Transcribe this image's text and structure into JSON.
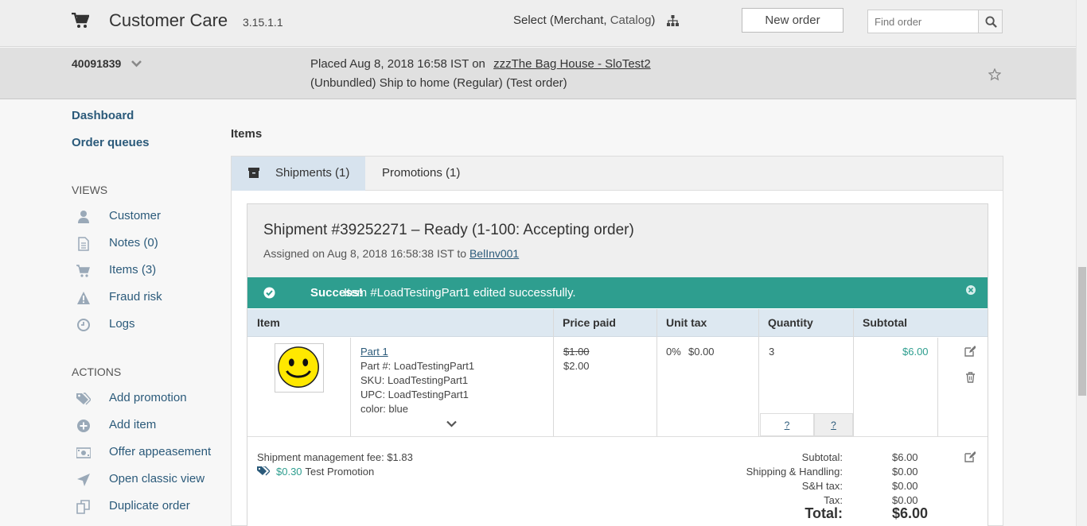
{
  "header": {
    "title": "Customer Care",
    "version": "3.15.1.1",
    "select_prefix": "Select (Merchant, ",
    "select_catalog": "Catalog",
    "select_suffix": ")",
    "new_order": "New order",
    "find_placeholder": "Find order"
  },
  "order": {
    "number": "40091839",
    "placed_text": "Placed Aug 8, 2018 16:58 IST on",
    "store_link": "zzzThe Bag House - SloTest2",
    "ship_text": "(Unbundled)  Ship to home (Regular) (Test order)"
  },
  "sidebar": {
    "dashboard": "Dashboard",
    "order_queues": "Order queues",
    "views_heading": "VIEWS",
    "views": [
      {
        "label": "Customer",
        "icon": "user-icon"
      },
      {
        "label": "Notes (0)",
        "icon": "document-icon"
      },
      {
        "label": "Items (3)",
        "icon": "cart-icon"
      },
      {
        "label": "Fraud risk",
        "icon": "warning-icon"
      },
      {
        "label": "Logs",
        "icon": "clock-icon"
      }
    ],
    "actions_heading": "ACTIONS",
    "actions": [
      {
        "label": "Add promotion",
        "icon": "tags-icon"
      },
      {
        "label": "Add item",
        "icon": "plus-circle-icon"
      },
      {
        "label": "Offer appeasement",
        "icon": "money-icon"
      },
      {
        "label": "Open classic view",
        "icon": "location-arrow-icon"
      },
      {
        "label": "Duplicate order",
        "icon": "copy-icon"
      }
    ]
  },
  "main": {
    "items_title": "Items",
    "tabs": [
      {
        "label": "Shipments (1)",
        "active": true
      },
      {
        "label": "Promotions (1)",
        "active": false
      }
    ],
    "shipment": {
      "title": "Shipment #39252271 – Ready (1-100: Accepting order)",
      "assigned_prefix": "Assigned on Aug 8, 2018 16:58:38 IST to ",
      "assigned_to": "BelInv001",
      "success_strong": "Success!",
      "success_msg": "Item #LoadTestingPart1 edited successfully.",
      "columns": [
        "Item",
        "Price paid",
        "Unit tax",
        "Quantity",
        "Subtotal"
      ],
      "item": {
        "name": "Part 1",
        "part_no": "Part #: LoadTestingPart1",
        "sku": "SKU: LoadTestingPart1",
        "upc": "UPC: LoadTestingPart1",
        "color": "color: blue",
        "price_old": "$1.00",
        "price_new": "$2.00",
        "tax_pct": "0%",
        "tax_amt": "$0.00",
        "quantity": "3",
        "qty_btn_1": "?",
        "qty_btn_2": "?",
        "subtotal": "$6.00"
      },
      "fee": "Shipment management fee: $1.83",
      "promo_amount": "$0.30",
      "promo_name": "Test Promotion",
      "summary": {
        "subtotal_label": "Subtotal:",
        "subtotal": "$6.00",
        "shipping_label": "Shipping & Handling:",
        "shipping": "$0.00",
        "sh_tax_label": "S&H tax:",
        "sh_tax": "$0.00",
        "tax_label": "Tax:",
        "tax": "$0.00",
        "total_label": "Total:",
        "total": "$6.00"
      }
    }
  },
  "colors": {
    "accent_teal": "#2e9e8f",
    "link_blue": "#2b5a7a",
    "tab_active": "#d7e3ee"
  }
}
